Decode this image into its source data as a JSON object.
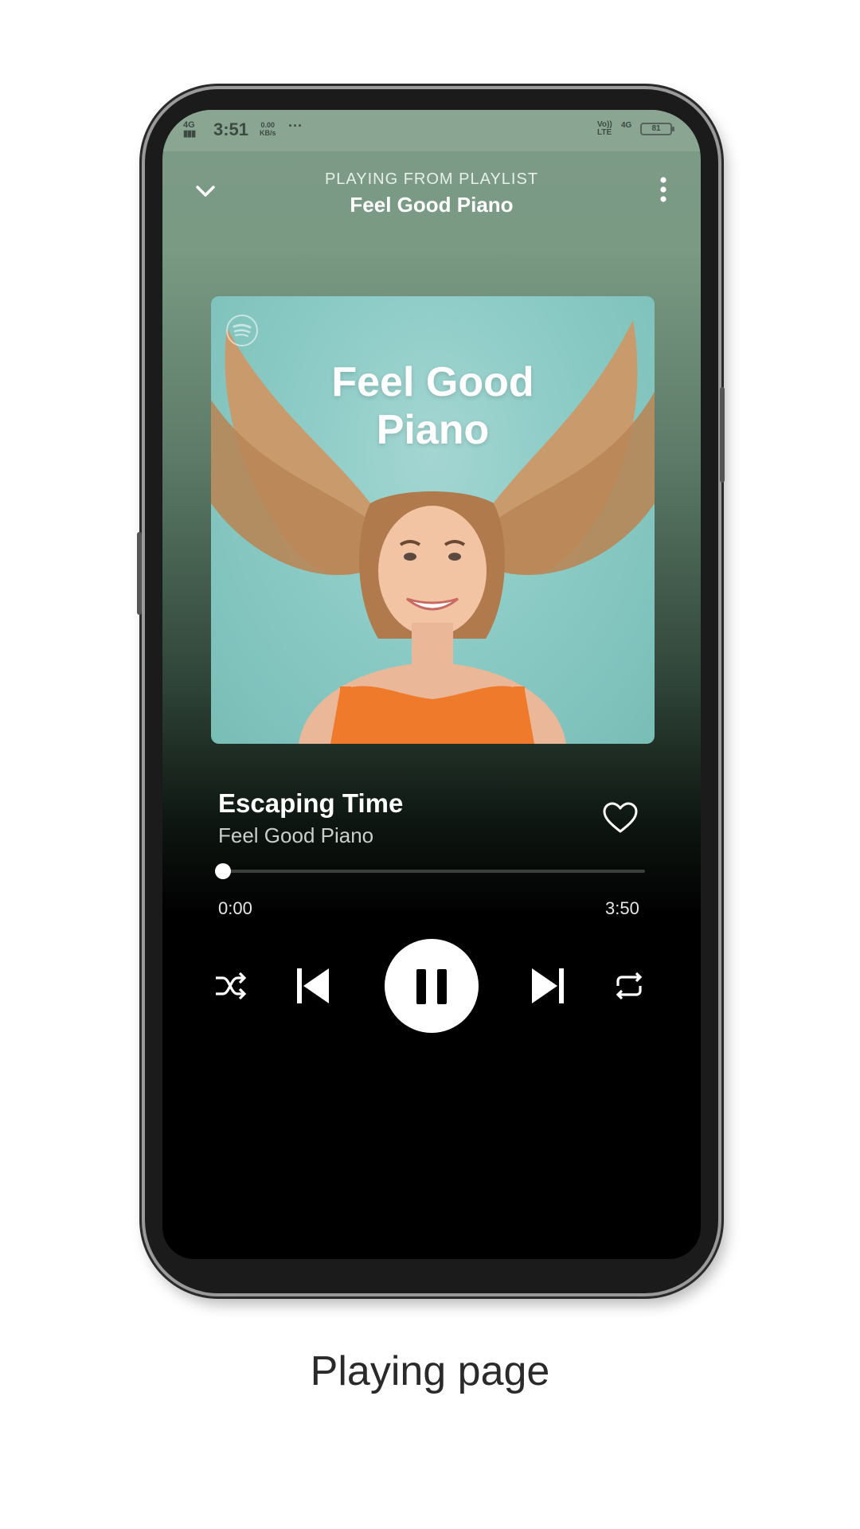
{
  "status_bar": {
    "network": "4G",
    "time": "3:51",
    "data_rate": "0.00",
    "data_rate_unit": "KB/s",
    "more": "···",
    "volte": "Vo))",
    "lte": "LTE",
    "signal_right": "4G",
    "battery": "81"
  },
  "header": {
    "context_label": "PLAYING FROM PLAYLIST",
    "playlist_name": "Feel Good Piano",
    "collapse_icon": "chevron-down-icon",
    "menu_icon": "more-vertical-icon"
  },
  "cover_art": {
    "title_line1": "Feel Good",
    "title_line2": "Piano",
    "logo_icon": "spotify-logo-icon"
  },
  "track": {
    "title": "Escaping Time",
    "artist": "Feel Good Piano",
    "liked": false
  },
  "playback": {
    "elapsed": "0:00",
    "duration": "3:50",
    "progress_fraction": 0.0,
    "state": "playing"
  },
  "controls": {
    "shuffle_icon": "shuffle-icon",
    "previous_icon": "skip-previous-icon",
    "pause_icon": "pause-icon",
    "next_icon": "skip-next-icon",
    "repeat_icon": "repeat-icon"
  },
  "caption": "Playing page",
  "colors": {
    "accent": "#ffffff",
    "background_top": "#7d9b87",
    "background_bottom": "#000000",
    "cover_bg": "#8ccbc6"
  }
}
